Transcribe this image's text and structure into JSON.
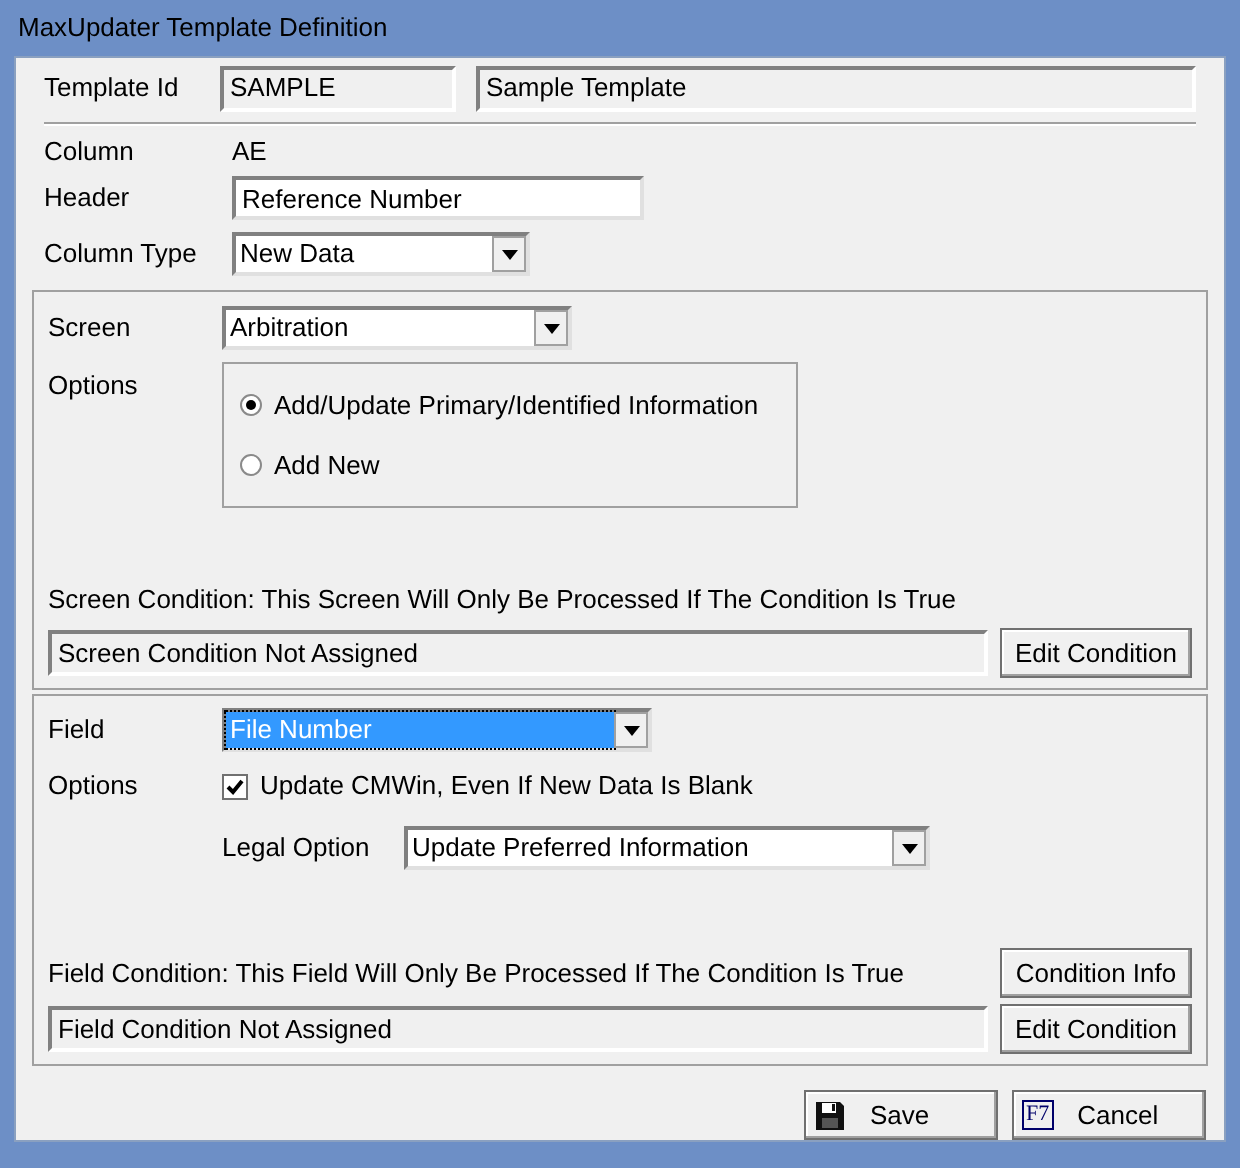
{
  "window": {
    "title": "MaxUpdater Template Definition"
  },
  "template": {
    "label": "Template Id",
    "id": "SAMPLE",
    "name": "Sample Template"
  },
  "column": {
    "label": "Column",
    "value": "AE"
  },
  "header": {
    "label": "Header",
    "value": "Reference Number"
  },
  "column_type": {
    "label": "Column Type",
    "value": "New Data"
  },
  "screen_section": {
    "label": "Screen",
    "value": "Arbitration",
    "options_label": "Options",
    "options": [
      {
        "label": "Add/Update Primary/Identified Information",
        "selected": true
      },
      {
        "label": "Add New",
        "selected": false
      }
    ],
    "condition_caption": "Screen Condition: This Screen Will Only Be Processed If The Condition Is True",
    "condition_value": "Screen Condition Not Assigned",
    "edit_button": "Edit Condition"
  },
  "field_section": {
    "label": "Field",
    "value": "File Number",
    "focused": true,
    "options_label": "Options",
    "checkbox": {
      "label": "Update CMWin, Even If New Data Is Blank",
      "checked": true
    },
    "legal_option": {
      "label": "Legal Option",
      "value": "Update Preferred Information"
    },
    "condition_caption": "Field Condition: This Field Will Only Be Processed If The Condition Is True",
    "info_button": "Condition Info",
    "condition_value": "Field Condition Not Assigned",
    "edit_button": "Edit Condition"
  },
  "buttons": [
    {
      "kind": "save",
      "label": "Save"
    },
    {
      "kind": "key",
      "key": "F7",
      "label": "Cancel"
    }
  ]
}
